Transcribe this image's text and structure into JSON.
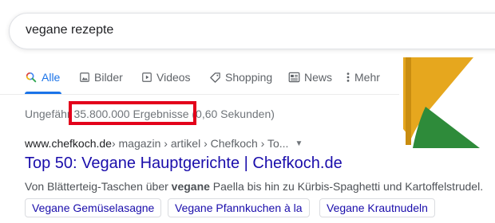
{
  "search": {
    "query": "vegane rezepte"
  },
  "tabs": [
    {
      "label": "Alle",
      "icon": "search-icon",
      "active": true
    },
    {
      "label": "Bilder",
      "icon": "image-icon"
    },
    {
      "label": "Videos",
      "icon": "video-icon"
    },
    {
      "label": "Shopping",
      "icon": "tag-icon"
    },
    {
      "label": "News",
      "icon": "news-icon"
    },
    {
      "label": "Mehr",
      "icon": "more-dots-icon"
    }
  ],
  "stats": {
    "prefix": "Ungefähr",
    "count": "35.800.000 Ergebnisse",
    "time": "(0,60 Sekunden)"
  },
  "result": {
    "cite_domain": "www.chefkoch.de",
    "cite_path": " › magazin › artikel › Chefkoch › To...",
    "title": "Top 50: Vegane Hauptgerichte | Chefkoch.de",
    "snippet_before": "Von Blätterteig-Taschen über ",
    "snippet_bold": "vegane",
    "snippet_after": " Paella bis hin zu Kürbis-Spaghetti und Kartoffelstrudel.",
    "chips": [
      "Vegane Gemüselasagne",
      "Vegane Pfannkuchen à la",
      "Vegane Krautnudeln"
    ]
  },
  "colors": {
    "accent": "#1a73e8",
    "link": "#1a0dab",
    "highlight": "#e3001b",
    "logo_yellow": "#e6a71e",
    "logo_green": "#2e8b3a"
  }
}
